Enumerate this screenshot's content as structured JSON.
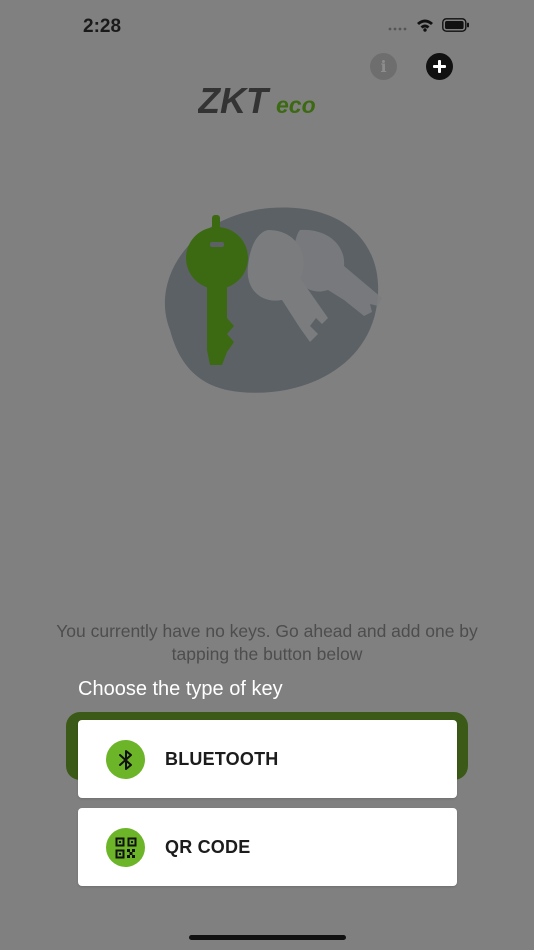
{
  "status_bar": {
    "time": "2:28",
    "icons": [
      "signal-icon",
      "wifi-icon",
      "battery-icon"
    ]
  },
  "header": {
    "info_icon": "info-icon",
    "info_glyph": "i",
    "add_icon": "plus-icon",
    "logo_text_zk": "ZKT",
    "logo_text_eco": "eco"
  },
  "hero": {
    "icon": "keys-illustration"
  },
  "main": {
    "empty_message": "You currently have no keys. Go ahead and add one by tapping the button below"
  },
  "sheet": {
    "title": "Choose the type of key",
    "options": [
      {
        "label": "BLUETOOTH",
        "icon": "bluetooth-icon"
      },
      {
        "label": "QR CODE",
        "icon": "qr-code-icon"
      }
    ]
  },
  "colors": {
    "overlay_background": "#808080",
    "brand_green": "#6cb428",
    "dark_green": "#3c5a17",
    "logo_gray": "#333333"
  }
}
